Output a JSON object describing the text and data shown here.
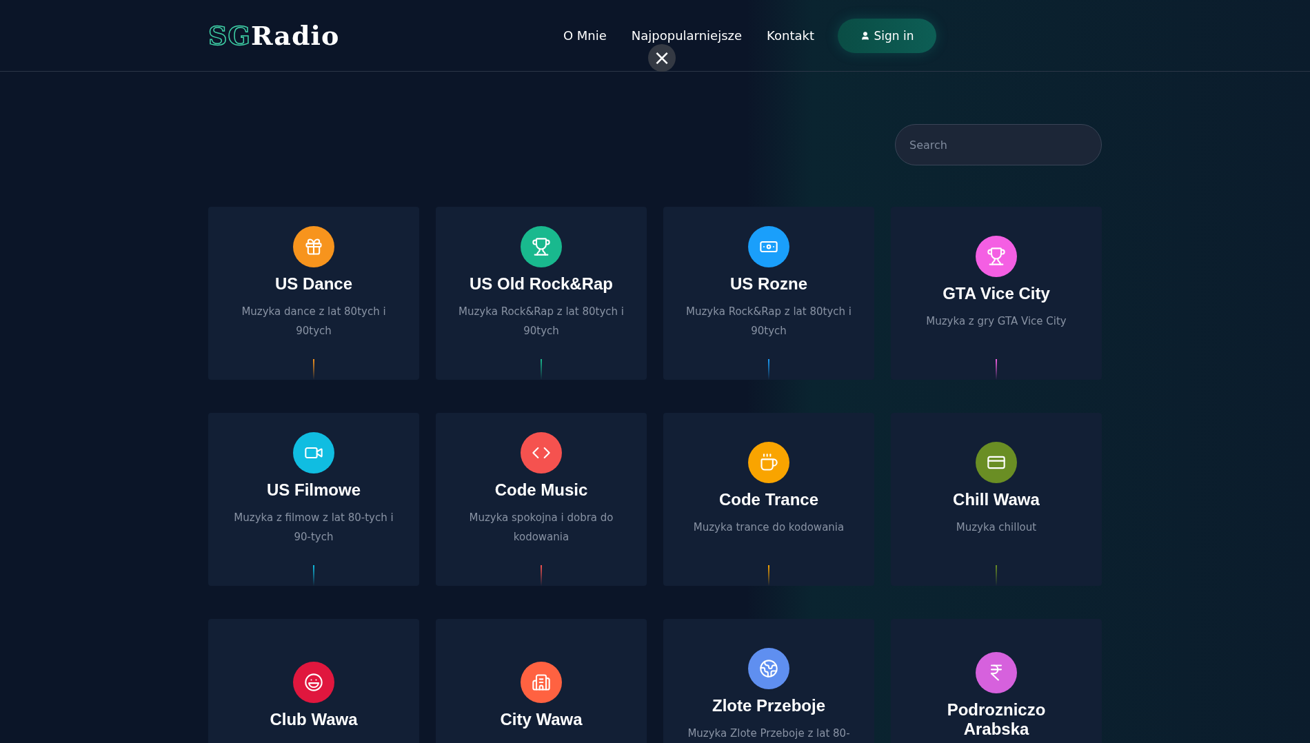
{
  "header": {
    "logo": {
      "prefix": "SG",
      "name": "Radio"
    },
    "nav": [
      "O Mnie",
      "Najpopularniejsze",
      "Kontakt"
    ],
    "sign_in": "Sign in",
    "close": "×"
  },
  "search": {
    "placeholder": "Search"
  },
  "stations": [
    {
      "title": "US Dance",
      "description": "Muzyka dance z lat 80tych i 90tych",
      "color": "#f7941d"
    },
    {
      "title": "US Old Rock&Rap",
      "description": "Muzyka Rock&Rap z lat 80tych i 90tych",
      "color": "#19b98e"
    },
    {
      "title": "US Rozne",
      "description": "Muzyka Rock&Rap z lat 80tych i 90tych",
      "color": "#1a9ffb"
    },
    {
      "title": "GTA Vice City",
      "description": "Muzyka z gry GTA Vice City",
      "color": "#f45fe3"
    },
    {
      "title": "US Filmowe",
      "description": "Muzyka z filmow z lat 80-tych i 90-tych",
      "color": "#10bde1"
    },
    {
      "title": "Code Music",
      "description": "Muzyka spokojna i dobra do kodowania",
      "color": "#f5524f"
    },
    {
      "title": "Code Trance",
      "description": "Muzyka trance do kodowania",
      "color": "#f9a400"
    },
    {
      "title": "Chill Wawa",
      "description": "Muzyka chillout",
      "color": "#6a8e24"
    },
    {
      "title": "Club Wawa",
      "color": "#e0173e"
    },
    {
      "title": "City Wawa",
      "color": "#ff6241"
    },
    {
      "title": "Zlote Przeboje",
      "description": "Muzyka Zlote Przeboje z lat 80-",
      "color": "#5f8ff0"
    },
    {
      "title": "Podrozniczo Arabska",
      "color": "#d661dd"
    }
  ]
}
